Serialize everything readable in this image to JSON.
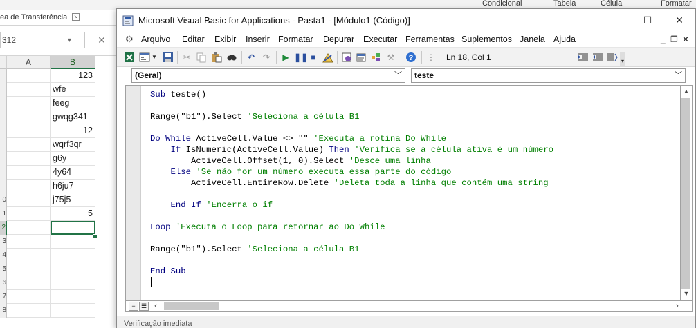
{
  "excel": {
    "ribbon_items": [
      "Condicional",
      "Tabela",
      "Célula",
      "Formatar"
    ],
    "ribbon_group_label": "ea de Transferência",
    "name_box": "312",
    "formula_cancel": "✕",
    "columns": [
      "A",
      "B"
    ],
    "row_numbers": [
      "",
      "",
      "",
      "",
      "",
      "",
      "",
      "",
      "",
      "0",
      "1",
      "2",
      "3",
      "4",
      "5",
      "6",
      "7",
      "8"
    ],
    "column_b_cells": [
      "123",
      "wfe",
      "feeg",
      "gwqg341",
      "12",
      "wqrf3qr",
      "g6y",
      "4y64",
      "h6ju7",
      "j75j5",
      "5",
      "",
      "",
      "",
      "",
      "",
      "",
      ""
    ],
    "numeric_rows": [
      0,
      4,
      10
    ],
    "active_row": 11
  },
  "vba": {
    "title": "Microsoft Visual Basic for Applications - Pasta1 - [Módulo1 (Código)]",
    "window_controls": {
      "minimize": "—",
      "maximize": "☐",
      "close": "✕"
    },
    "menus": [
      "Arquivo",
      "Editar",
      "Exibir",
      "Inserir",
      "Formatar",
      "Depurar",
      "Executar",
      "Ferramentas",
      "Suplementos",
      "Janela",
      "Ajuda"
    ],
    "mdi_controls": {
      "minimize": "_",
      "restore": "❐",
      "close": "✕"
    },
    "toolbar_icons": [
      "excel-icon",
      "insert-module-icon",
      "dropdown-arrow-icon",
      "save-icon",
      "cut-icon",
      "copy-icon",
      "paste-icon",
      "find-icon",
      "undo-icon",
      "redo-icon",
      "run-icon",
      "pause-icon",
      "stop-icon",
      "design-mode-icon",
      "project-explorer-icon",
      "properties-icon",
      "object-browser-icon",
      "toolbox-icon",
      "help-icon"
    ],
    "cursor_position": "Ln 18, Col 1",
    "object_combo": "(Geral)",
    "procedure_combo": "teste",
    "code_lines": [
      [
        {
          "t": "Sub ",
          "k": "kw"
        },
        {
          "t": "teste()",
          "k": "n"
        }
      ],
      [],
      [
        {
          "t": "Range(\"b1\").Select ",
          "k": "n"
        },
        {
          "t": "'Seleciona a célula B1",
          "k": "cm"
        }
      ],
      [],
      [
        {
          "t": "Do While ",
          "k": "kw"
        },
        {
          "t": "ActiveCell.Value <> \"\" ",
          "k": "n"
        },
        {
          "t": "'Executa a rotina Do While",
          "k": "cm"
        }
      ],
      [
        {
          "t": "    If ",
          "k": "kw"
        },
        {
          "t": "IsNumeric(ActiveCell.Value) ",
          "k": "n"
        },
        {
          "t": "Then ",
          "k": "kw"
        },
        {
          "t": "'Verifica se a célula ativa é um número",
          "k": "cm"
        }
      ],
      [
        {
          "t": "        ActiveCell.Offset(1, 0).Select ",
          "k": "n"
        },
        {
          "t": "'Desce uma linha",
          "k": "cm"
        }
      ],
      [
        {
          "t": "    Else ",
          "k": "kw"
        },
        {
          "t": "'Se não for um número executa essa parte do código",
          "k": "cm"
        }
      ],
      [
        {
          "t": "        ActiveCell.EntireRow.Delete ",
          "k": "n"
        },
        {
          "t": "'Deleta toda a linha que contém uma string",
          "k": "cm"
        }
      ],
      [],
      [
        {
          "t": "    End If ",
          "k": "kw"
        },
        {
          "t": "'Encerra o if",
          "k": "cm"
        }
      ],
      [],
      [
        {
          "t": "Loop ",
          "k": "kw"
        },
        {
          "t": "'Executa o Loop para retornar ao Do While",
          "k": "cm"
        }
      ],
      [],
      [
        {
          "t": "Range(\"b1\").Select ",
          "k": "n"
        },
        {
          "t": "'Seleciona a célula B1",
          "k": "cm"
        }
      ],
      [],
      [
        {
          "t": "End Sub",
          "k": "kw"
        }
      ],
      []
    ],
    "bottom_panel_text": "Verificação imediata"
  },
  "colors": {
    "keyword": "#00007f",
    "comment": "#007f00",
    "excel_accent": "#217346"
  }
}
